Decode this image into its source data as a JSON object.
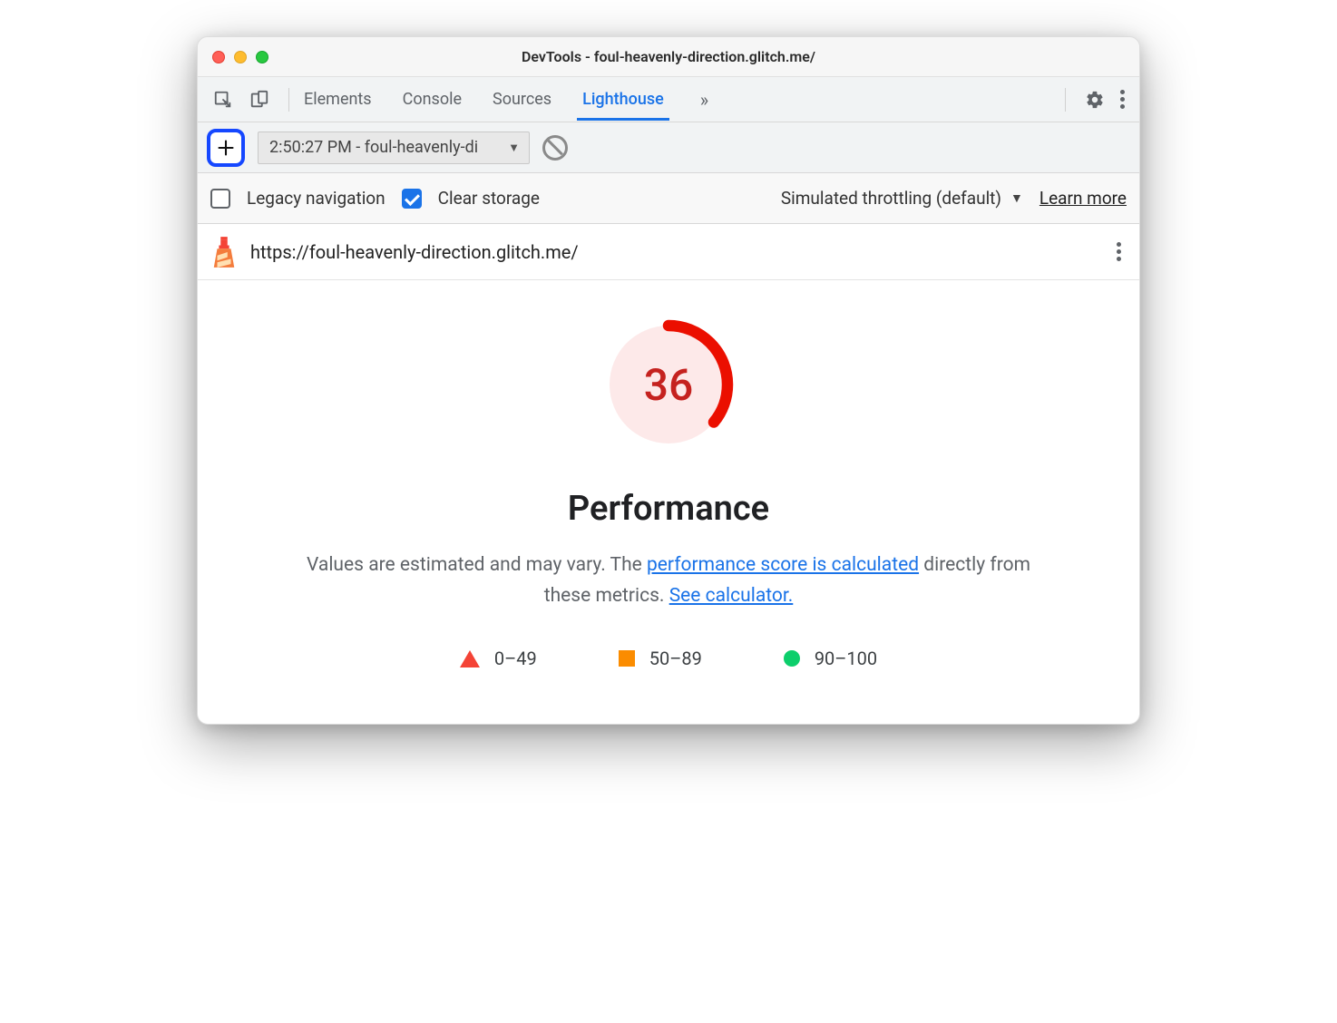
{
  "window": {
    "title": "DevTools - foul-heavenly-direction.glitch.me/"
  },
  "toolbar": {
    "tabs": [
      {
        "label": "Elements",
        "active": false
      },
      {
        "label": "Console",
        "active": false
      },
      {
        "label": "Sources",
        "active": false
      },
      {
        "label": "Lighthouse",
        "active": true
      }
    ]
  },
  "subbar": {
    "report_select": "2:50:27 PM - foul-heavenly-di"
  },
  "options": {
    "legacy_label": "Legacy navigation",
    "legacy_checked": false,
    "clear_label": "Clear storage",
    "clear_checked": true,
    "throttling_label": "Simulated throttling (default)",
    "learn_more": "Learn more"
  },
  "report": {
    "url": "https://foul-heavenly-direction.glitch.me/"
  },
  "performance": {
    "score": "36",
    "heading": "Performance",
    "desc_pre": "Values are estimated and may vary. The ",
    "link1": "performance score is calculated",
    "desc_mid": " directly from these metrics. ",
    "link2": "See calculator."
  },
  "legend": {
    "poor": "0–49",
    "avg": "50–89",
    "good": "90–100"
  },
  "chart_data": {
    "type": "pie",
    "title": "Performance",
    "values": [
      36
    ],
    "categories": [
      "Performance score"
    ],
    "ylim": [
      0,
      100
    ],
    "score": 36,
    "status": "poor",
    "thresholds": {
      "poor": [
        0,
        49
      ],
      "average": [
        50,
        89
      ],
      "good": [
        90,
        100
      ]
    }
  }
}
